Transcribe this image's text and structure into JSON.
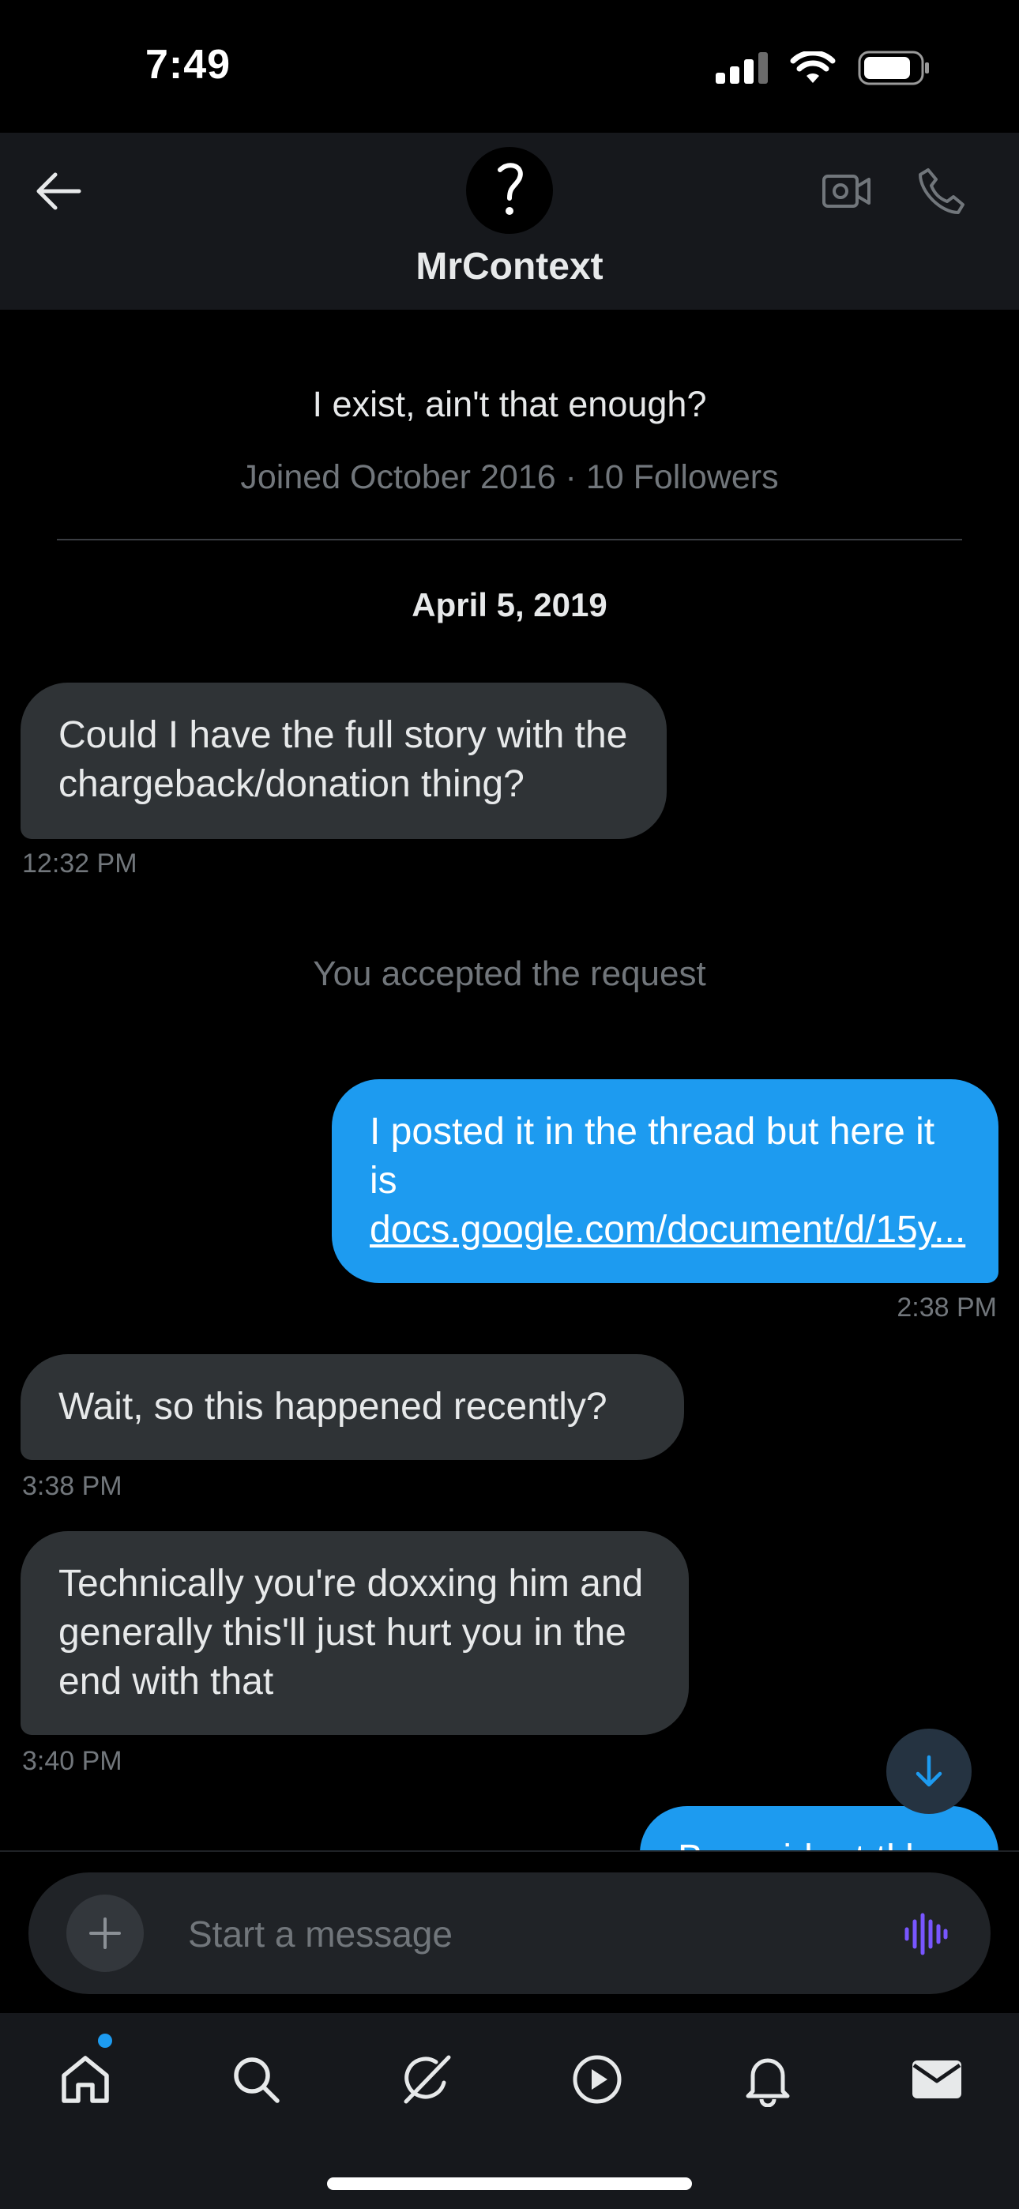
{
  "status_bar": {
    "time": "7:49"
  },
  "header": {
    "title": "MrContext"
  },
  "profile": {
    "bio": "I exist, ain't that enough?",
    "meta": "Joined October 2016 · 10 Followers"
  },
  "conversation": {
    "date_separator": "April 5, 2019",
    "system_message": "You accepted the request",
    "messages": [
      {
        "direction": "received",
        "text": "Could I have the full story with the chargeback/donation thing?",
        "time": "12:32 PM"
      },
      {
        "direction": "sent",
        "text_prefix": "I posted it in the thread but here it is ",
        "link_text": "docs.google.com/document/d/15y...",
        "time": "2:38 PM"
      },
      {
        "direction": "received",
        "text": "Wait, so this happened recently?",
        "time": "3:38 PM"
      },
      {
        "direction": "received",
        "text": "Technically you're doxxing him and generally this'll just hurt you in the end with that",
        "time": "3:40 PM"
      },
      {
        "direction": "sent",
        "text": "Bussoidont tkb"
      }
    ]
  },
  "composer": {
    "placeholder": "Start a message"
  },
  "nav": {
    "items": [
      "home-icon",
      "search-icon",
      "grok-icon",
      "video-icon",
      "notifications-icon",
      "messages-icon"
    ],
    "accent": "#1d9bf0"
  },
  "colors": {
    "sent_bubble": "#1d9bf0",
    "received_bubble": "#2f3336",
    "voice_icon": "#7856ff"
  }
}
